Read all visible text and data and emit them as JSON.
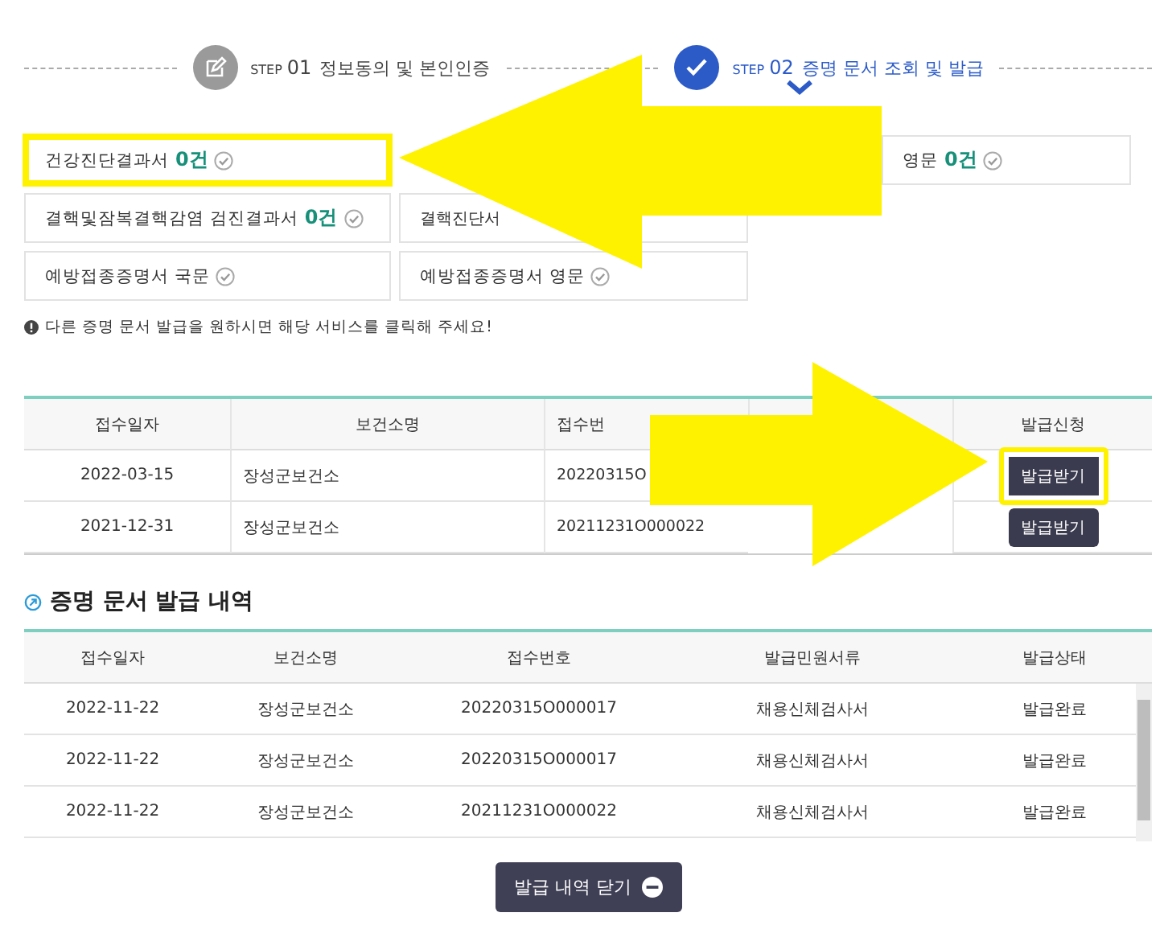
{
  "steps": [
    {
      "prefix": "STEP",
      "number": "01",
      "label": "정보동의 및 본인인증",
      "selected": false
    },
    {
      "prefix": "STEP",
      "number": "02",
      "label": "증명 문서 조회 및 발급",
      "selected": true
    }
  ],
  "cards": [
    {
      "kind": "card",
      "label": "건강진단결과서",
      "count": "0건",
      "highlighted": true
    },
    {
      "kind": "gap"
    },
    {
      "kind": "clipped",
      "label": "영문",
      "count": "0건",
      "highlighted": false
    },
    {
      "kind": "card",
      "label": "결핵및잠복결핵감염 검진결과서",
      "count": "0건",
      "highlighted": false
    },
    {
      "kind": "covered",
      "label": "결핵진단서"
    },
    {
      "kind": "gap"
    },
    {
      "kind": "card",
      "label": "예방접종증명서 국문",
      "highlighted": false
    },
    {
      "kind": "card",
      "label": "예방접종증명서 영문",
      "highlighted": false
    }
  ],
  "notice": "다른 증명 문서 발급을 원하시면 해당 서비스를 클릭해 주세요!",
  "request_table": {
    "columns": [
      {
        "kind": "text",
        "label": "접수일자"
      },
      {
        "kind": "text",
        "label": "보건소명"
      },
      {
        "kind": "text",
        "label": "접수번"
      },
      {
        "kind": "blank"
      },
      {
        "kind": "text",
        "label": "발급신청"
      }
    ],
    "rows": [
      {
        "date": "2022-03-15",
        "center": "장성군보건소",
        "number": "20220315O",
        "button": "발급받기",
        "highlighted": true
      },
      {
        "date": "2021-12-31",
        "center": "장성군보건소",
        "number": "20211231O000022",
        "button": "발급받기",
        "highlighted": false
      }
    ]
  },
  "history": {
    "title": "증명 문서 발급 내역",
    "columns": [
      "접수일자",
      "보건소명",
      "접수번호",
      "발급민원서류",
      "발급상태"
    ],
    "rows": [
      [
        "2022-11-22",
        "장성군보건소",
        "20220315O000017",
        "채용신체검사서",
        "발급완료"
      ],
      [
        "2022-11-22",
        "장성군보건소",
        "20220315O000017",
        "채용신체검사서",
        "발급완료"
      ],
      [
        "2022-11-22",
        "장성군보건소",
        "20211231O000022",
        "채용신체검사서",
        "발급완료"
      ]
    ]
  },
  "close_button": "발급 내역 닫기"
}
